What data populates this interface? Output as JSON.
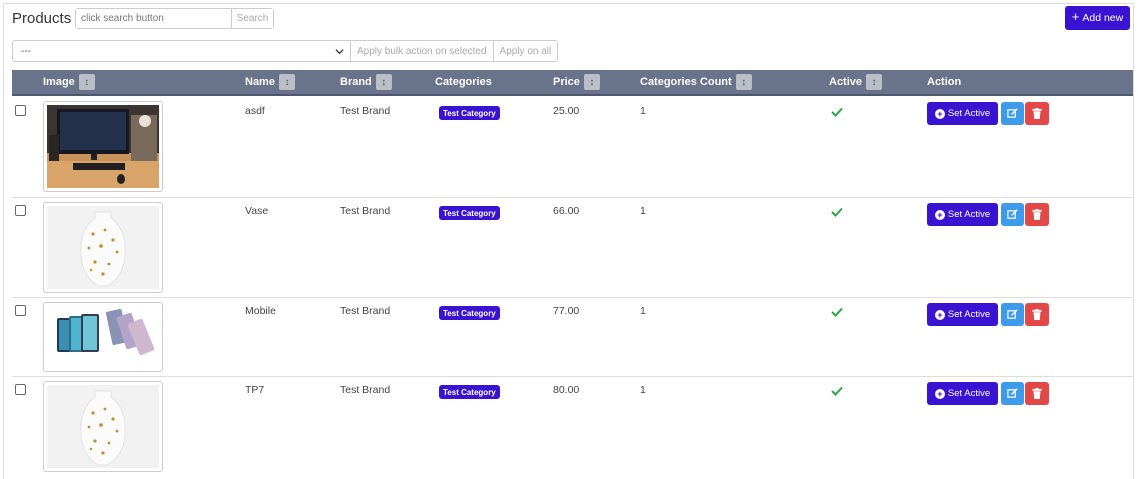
{
  "header": {
    "title": "Products",
    "search_placeholder": "click search button",
    "search_button": "Search",
    "add_button": "Add new"
  },
  "bulk": {
    "selected": "---",
    "apply_selected": "Apply bulk action on selected",
    "apply_all": "Apply on all"
  },
  "table": {
    "columns": {
      "image": "Image",
      "name": "Name",
      "brand": "Brand",
      "categories": "Categories",
      "price": "Price",
      "categories_count": "Categories Count",
      "active": "Active",
      "action": "Action"
    },
    "set_active_label": "Set Active",
    "rows": [
      {
        "image": "desk-photo",
        "name": "asdf",
        "brand": "Test Brand",
        "category": "Test Category",
        "price": "25.00",
        "count": "1",
        "active": true
      },
      {
        "image": "vase-photo",
        "name": "Vase",
        "brand": "Test Brand",
        "category": "Test Category",
        "price": "66.00",
        "count": "1",
        "active": true
      },
      {
        "image": "mobile-photo",
        "name": "Mobile",
        "brand": "Test Brand",
        "category": "Test Category",
        "price": "77.00",
        "count": "1",
        "active": true
      },
      {
        "image": "vase-photo",
        "name": "TP7",
        "brand": "Test Brand",
        "category": "Test Category",
        "price": "80.00",
        "count": "1",
        "active": true
      }
    ]
  },
  "colors": {
    "primary": "#3a12d2",
    "header_bg": "#69738a",
    "edit": "#3d9be9",
    "delete": "#e34848",
    "check": "#28a745"
  }
}
